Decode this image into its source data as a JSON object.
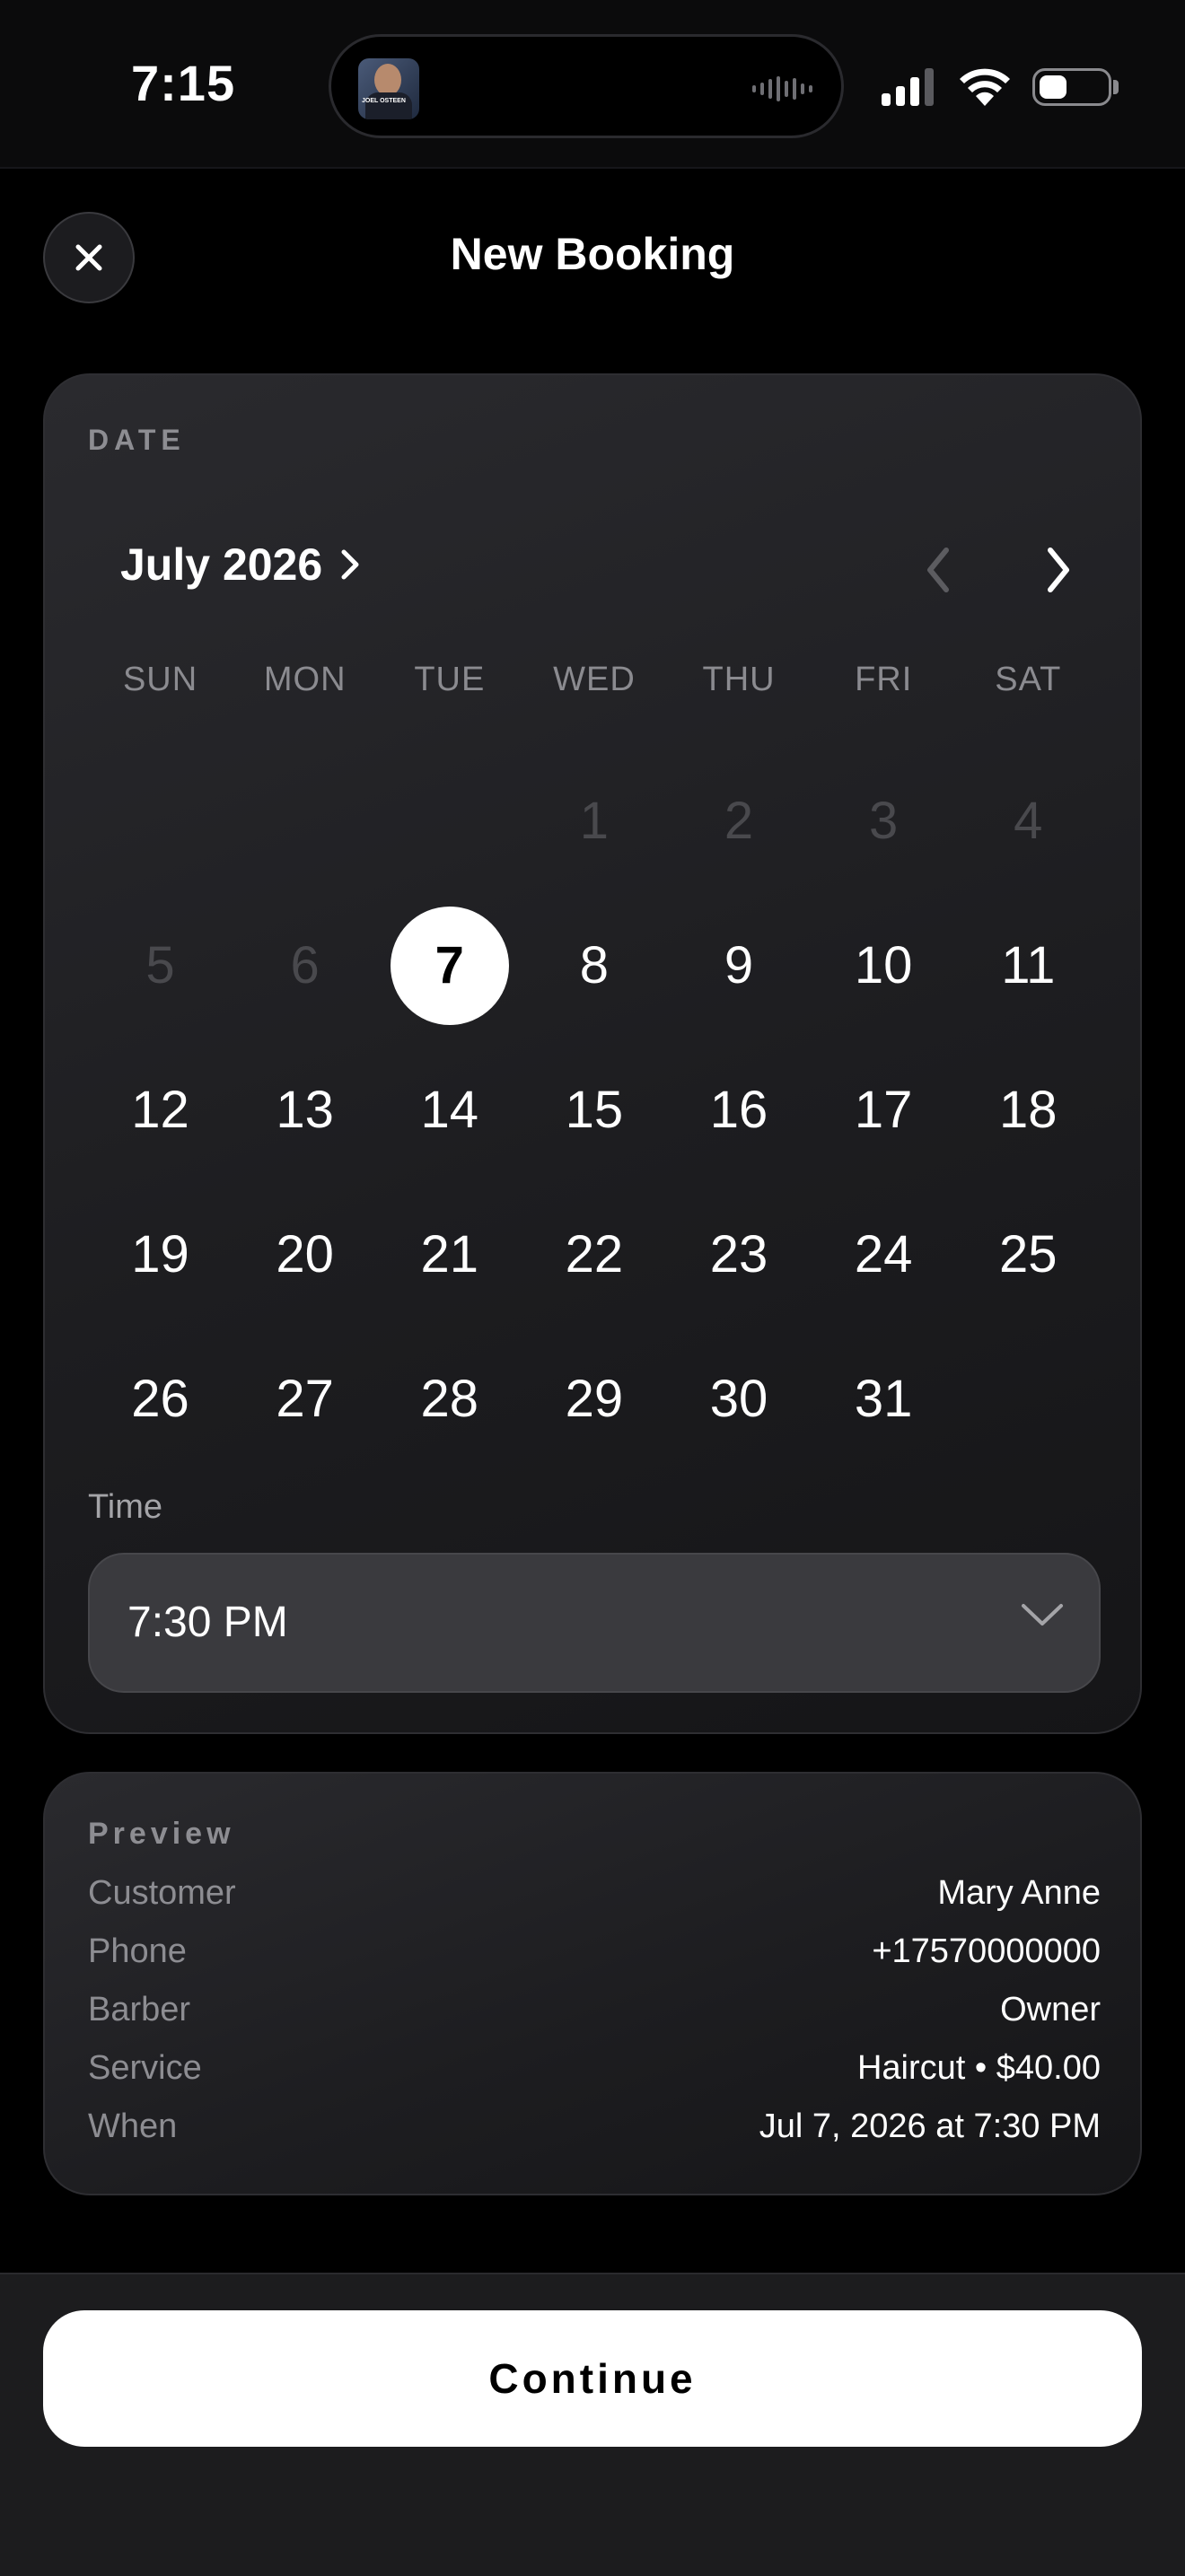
{
  "status_bar": {
    "time": "7:15",
    "now_playing_art_text": "JOEL OSTEEN"
  },
  "header": {
    "title": "New Booking",
    "close_icon": "close-icon"
  },
  "date_section": {
    "label": "DATE",
    "month_label": "July 2026",
    "weekdays": [
      "SUN",
      "MON",
      "TUE",
      "WED",
      "THU",
      "FRI",
      "SAT"
    ],
    "days": [
      {
        "d": "",
        "state": "empty"
      },
      {
        "d": "",
        "state": "empty"
      },
      {
        "d": "",
        "state": "empty"
      },
      {
        "d": "1",
        "state": "disabled"
      },
      {
        "d": "2",
        "state": "disabled"
      },
      {
        "d": "3",
        "state": "disabled"
      },
      {
        "d": "4",
        "state": "disabled"
      },
      {
        "d": "5",
        "state": "disabled"
      },
      {
        "d": "6",
        "state": "disabled"
      },
      {
        "d": "7",
        "state": "selected"
      },
      {
        "d": "8",
        "state": "enabled"
      },
      {
        "d": "9",
        "state": "enabled"
      },
      {
        "d": "10",
        "state": "enabled"
      },
      {
        "d": "11",
        "state": "enabled"
      },
      {
        "d": "12",
        "state": "enabled"
      },
      {
        "d": "13",
        "state": "enabled"
      },
      {
        "d": "14",
        "state": "enabled"
      },
      {
        "d": "15",
        "state": "enabled"
      },
      {
        "d": "16",
        "state": "enabled"
      },
      {
        "d": "17",
        "state": "enabled"
      },
      {
        "d": "18",
        "state": "enabled"
      },
      {
        "d": "19",
        "state": "enabled"
      },
      {
        "d": "20",
        "state": "enabled"
      },
      {
        "d": "21",
        "state": "enabled"
      },
      {
        "d": "22",
        "state": "enabled"
      },
      {
        "d": "23",
        "state": "enabled"
      },
      {
        "d": "24",
        "state": "enabled"
      },
      {
        "d": "25",
        "state": "enabled"
      },
      {
        "d": "26",
        "state": "enabled"
      },
      {
        "d": "27",
        "state": "enabled"
      },
      {
        "d": "28",
        "state": "enabled"
      },
      {
        "d": "29",
        "state": "enabled"
      },
      {
        "d": "30",
        "state": "enabled"
      },
      {
        "d": "31",
        "state": "enabled"
      }
    ],
    "time_label": "Time",
    "time_value": "7:30 PM"
  },
  "preview": {
    "label": "Preview",
    "rows": [
      {
        "key": "Customer",
        "value": "Mary Anne"
      },
      {
        "key": "Phone",
        "value": "+17570000000"
      },
      {
        "key": "Barber",
        "value": "Owner"
      },
      {
        "key": "Service",
        "value": "Haircut • $40.00"
      },
      {
        "key": "When",
        "value": "Jul 7, 2026 at 7:30 PM"
      }
    ]
  },
  "footer": {
    "continue_label": "Continue"
  },
  "colors": {
    "background": "#000000",
    "card": "#232326",
    "selected_day_bg": "#ffffff",
    "disabled_day": "#49494d",
    "muted_text": "#8d8d92",
    "button_bg": "#ffffff"
  }
}
